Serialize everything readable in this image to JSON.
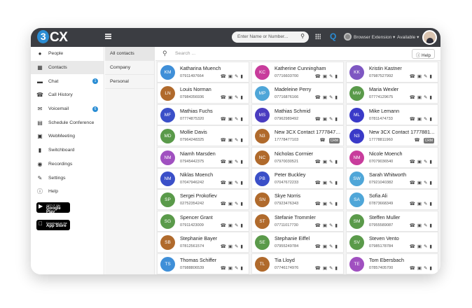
{
  "header": {
    "logo_text": "3CX",
    "search_placeholder": "Enter Name or Number...",
    "extension_label": "Browser Extension",
    "status_label": "Available"
  },
  "sidebar": {
    "items": [
      {
        "label": "People",
        "icon": "person-icon",
        "badge": ""
      },
      {
        "label": "Contacts",
        "icon": "contacts-icon",
        "badge": ""
      },
      {
        "label": "Chat",
        "icon": "chat-icon",
        "badge": "1"
      },
      {
        "label": "Call History",
        "icon": "phone-icon",
        "badge": ""
      },
      {
        "label": "Voicemail",
        "icon": "voicemail-icon",
        "badge": "6"
      },
      {
        "label": "Schedule Conference",
        "icon": "calendar-icon",
        "badge": ""
      },
      {
        "label": "WebMeeting",
        "icon": "webmeeting-icon",
        "badge": ""
      },
      {
        "label": "Switchboard",
        "icon": "switchboard-icon",
        "badge": ""
      },
      {
        "label": "Recordings",
        "icon": "microphone-icon",
        "badge": ""
      },
      {
        "label": "Settings",
        "icon": "wrench-icon",
        "badge": ""
      },
      {
        "label": "Help",
        "icon": "info-icon",
        "badge": ""
      }
    ],
    "active": "Contacts",
    "google_play": {
      "small": "GET IT ON",
      "big": "Google Play"
    },
    "app_store": {
      "small": "Download on the",
      "big": "App Store"
    }
  },
  "subnav": {
    "items": [
      "All contacts",
      "Company",
      "Personal"
    ],
    "active": "All contacts"
  },
  "content": {
    "search_placeholder": "Search ...",
    "help_label": "Help"
  },
  "contacts": [
    {
      "initials": "KM",
      "name": "Katharina Muench",
      "phone": "07911497664",
      "color": "#3f8fd8"
    },
    {
      "initials": "KC",
      "name": "Katherine Cunningham",
      "phone": "07716603700",
      "color": "#c83c9c"
    },
    {
      "initials": "KK",
      "name": "Kristin Kastner",
      "phone": "07987527992",
      "color": "#7e57c2"
    },
    {
      "initials": "LN",
      "name": "Louis Norman",
      "phone": "07984356936",
      "color": "#b06a2c"
    },
    {
      "initials": "MP",
      "name": "Madeleine Perry",
      "phone": "07716876166",
      "color": "#4fa6d8"
    },
    {
      "initials": "MW",
      "name": "Maria Wexler",
      "phone": "07774129675",
      "color": "#5a9a4a"
    },
    {
      "initials": "MF",
      "name": "Mathias Fuchs",
      "phone": "07774875320",
      "color": "#3a4fc8"
    },
    {
      "initials": "MS",
      "name": "Mathias Schmid",
      "phone": "07962989492",
      "color": "#4a3cc0"
    },
    {
      "initials": "ML",
      "name": "Mike Lemann",
      "phone": "07811474733",
      "color": "#3a3ac8"
    },
    {
      "initials": "MD",
      "name": "Mollie Davis",
      "phone": "07964248325",
      "color": "#5a9a4a"
    },
    {
      "initials": "N3",
      "name": "New 3CX Contact 17778477…",
      "phone": "17778477103",
      "color": "#b06a2c",
      "crm": "CRM"
    },
    {
      "initials": "N3",
      "name": "New 3CX Contact 17778811…",
      "phone": "17778811960",
      "color": "#3a3ac8",
      "crm": "CRM"
    },
    {
      "initials": "NM",
      "name": "Niamh Marsden",
      "phone": "07945442375",
      "color": "#a050c0"
    },
    {
      "initials": "NC",
      "name": "Nicholas Cormier",
      "phone": "07970030521",
      "color": "#b06a2c"
    },
    {
      "initials": "NM",
      "name": "Nicole Moench",
      "phone": "07079036540",
      "color": "#c83c9c"
    },
    {
      "initials": "NM",
      "name": "Niklas Moench",
      "phone": "07047946242",
      "color": "#3a4fc8"
    },
    {
      "initials": "PB",
      "name": "Peter Buckley",
      "phone": "07047672233",
      "color": "#3a4fc8"
    },
    {
      "initials": "SW",
      "name": "Sarah Whitworth",
      "phone": "07921040382",
      "color": "#4fa6d8"
    },
    {
      "initials": "SP",
      "name": "Sergei Prokofiev",
      "phone": "02752354242",
      "color": "#5a9a4a"
    },
    {
      "initials": "SN",
      "name": "Skye Norris",
      "phone": "07923476343",
      "color": "#b06a2c"
    },
    {
      "initials": "SA",
      "name": "Sofia Ali",
      "phone": "07873668349",
      "color": "#4fa6d8"
    },
    {
      "initials": "SG",
      "name": "Spencer Grant",
      "phone": "07911423009",
      "color": "#5a9a4a"
    },
    {
      "initials": "ST",
      "name": "Stefanie Trommler",
      "phone": "07711017730",
      "color": "#b06a2c"
    },
    {
      "initials": "SM",
      "name": "Steffen Muller",
      "phone": "07955589087",
      "color": "#5a9a4a"
    },
    {
      "initials": "SB",
      "name": "Stephanie Bayer",
      "phone": "07812561574",
      "color": "#b06a2c"
    },
    {
      "initials": "SE",
      "name": "Stephanie Eiffel",
      "phone": "07955249784",
      "color": "#5a9a4a"
    },
    {
      "initials": "SV",
      "name": "Steven Vento",
      "phone": "07985178784",
      "color": "#5a9a4a"
    },
    {
      "initials": "TS",
      "name": "Thomas Schiffer",
      "phone": "07988806539",
      "color": "#3f8fd8"
    },
    {
      "initials": "TL",
      "name": "Tia Lloyd",
      "phone": "07746174976",
      "color": "#b06a2c"
    },
    {
      "initials": "TE",
      "name": "Tom Ebersbach",
      "phone": "07857405700",
      "color": "#a050c0"
    }
  ]
}
